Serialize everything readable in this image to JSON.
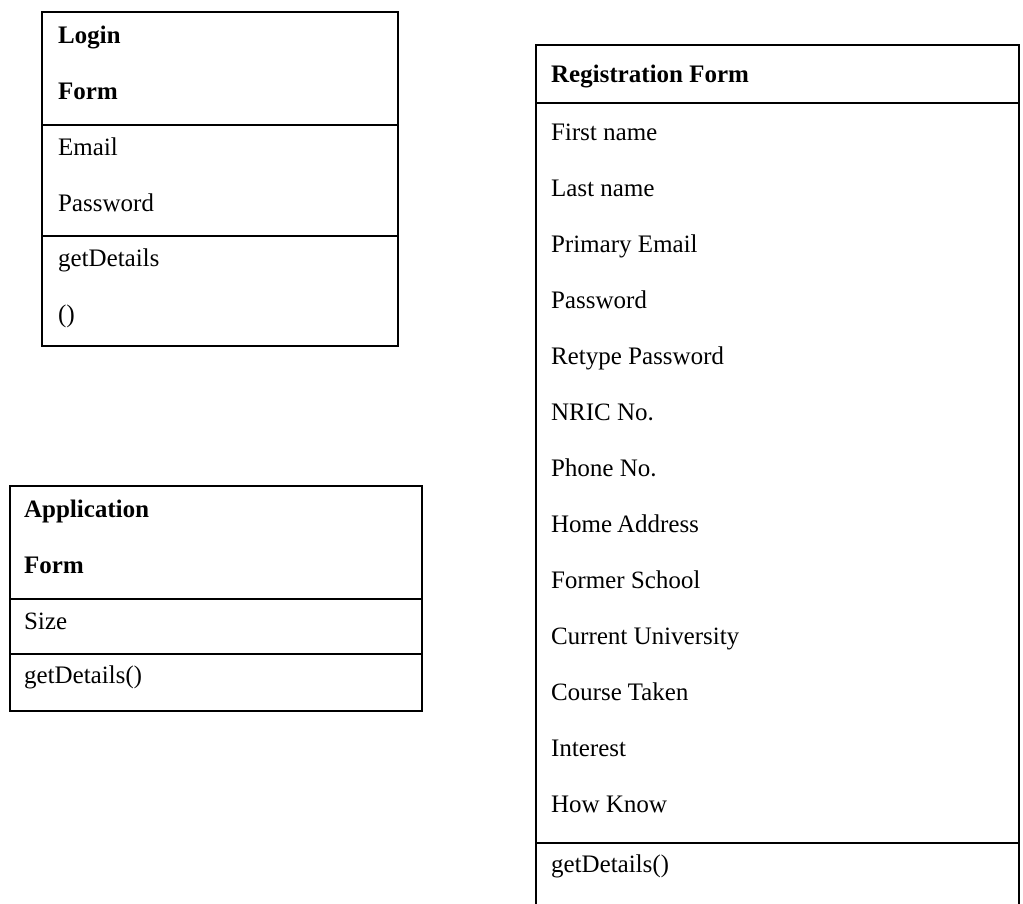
{
  "login_form": {
    "title_line1": "Login",
    "title_line2": "Form",
    "attributes": [
      "Email",
      "Password"
    ],
    "method_line1": "getDetails",
    "method_line2": "()"
  },
  "application_form": {
    "title_line1": "Application",
    "title_line2": "Form",
    "attributes": [
      "Size"
    ],
    "methods": [
      "getDetails()"
    ]
  },
  "registration_form": {
    "title": "Registration Form",
    "attributes": [
      "First name",
      "Last name",
      "Primary Email",
      "Password",
      "Retype Password",
      "NRIC No.",
      "Phone No.",
      "Home Address",
      "Former School",
      "Current University",
      "Course Taken",
      "Interest",
      "How Know"
    ],
    "methods": [
      "getDetails()"
    ]
  }
}
